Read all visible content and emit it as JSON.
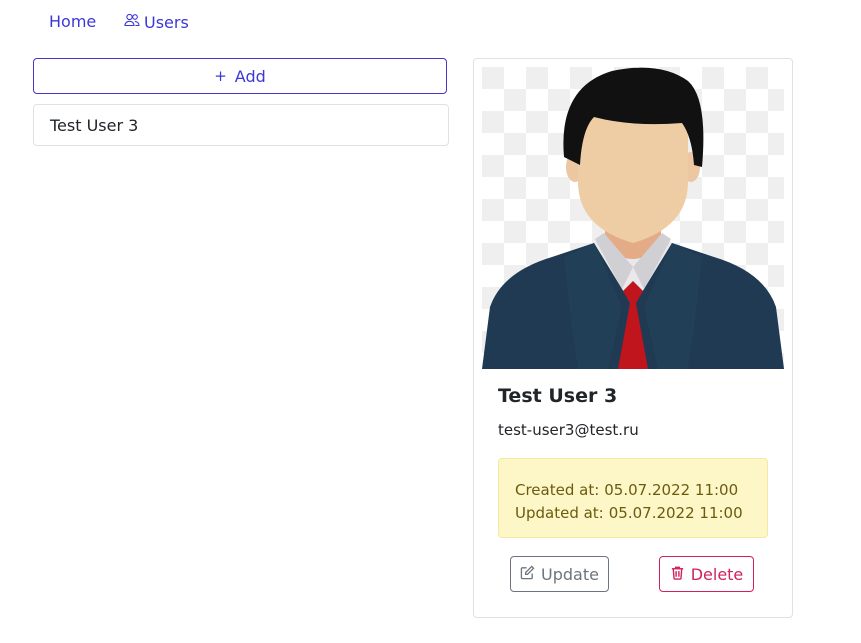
{
  "nav": {
    "home_label": "Home",
    "users_label": "Users",
    "users_icon": "people-icon"
  },
  "users_list": {
    "add_label": "Add",
    "add_icon": "plus-icon",
    "items": [
      {
        "name": "Test User 3"
      }
    ]
  },
  "user_card": {
    "avatar": "default-male-avatar",
    "name": "Test User 3",
    "email": "test-user3@test.ru",
    "created_label": "Created at:",
    "created_value": "05.07.2022 11:00",
    "updated_label": "Updated at:",
    "updated_value": "05.07.2022 11:00",
    "update_label": "Update",
    "update_icon": "pencil-square-icon",
    "delete_label": "Delete",
    "delete_icon": "trash-icon"
  },
  "colors": {
    "link": "#3d37d8",
    "add_border": "#4a35c9",
    "warning_bg": "#fdf6c6",
    "warning_text": "#6b5b10",
    "secondary": "#6c757d",
    "danger": "#d0225b"
  }
}
